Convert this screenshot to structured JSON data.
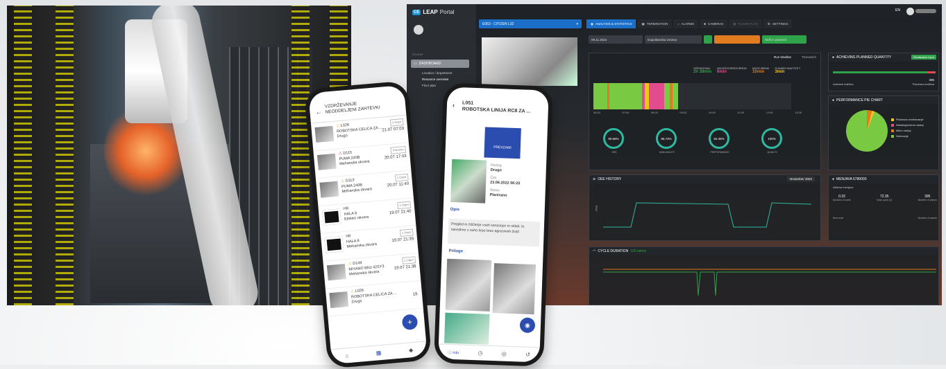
{
  "dashboard": {
    "brand": {
      "logo": "CE",
      "name": "LEAP",
      "portal": "Portal"
    },
    "sidebar": {
      "section": "ECLEAP",
      "dashboard_label": "DASHBOARD",
      "items": [
        "Location / department",
        "Resource overview",
        "Floor plan"
      ]
    },
    "machine_select": "E053 - CITIZEN L32",
    "tabs": [
      {
        "label": "ANALYSIS & STATISTICS",
        "icon": "chart-icon"
      },
      {
        "label": "TERMINATION",
        "icon": "stop-icon"
      },
      {
        "label": "ALARMS",
        "icon": "bell-icon"
      },
      {
        "label": "CAMERAS",
        "icon": "camera-icon"
      },
      {
        "label": "FLOOR PLAN",
        "icon": "map-icon"
      },
      {
        "label": "SETTINGS",
        "icon": "gear-icon"
      }
    ],
    "language": "EN",
    "controls": {
      "date": "09.11.2022",
      "period": "Dopoldanska izmena",
      "shift_btn": "Shift in planned"
    },
    "timeline": {
      "title": "Run timeline",
      "tab2": "Textswitch",
      "legend": [
        {
          "label": "OPERATIONAL",
          "value": "2h 38min",
          "color": "#2fa34a"
        },
        {
          "label": "UNCATEGORIZED BREAK",
          "value": "6min",
          "color": "#e24b8e"
        },
        {
          "label": "MICRO BREAK",
          "value": "10min",
          "color": "#e07b20"
        },
        {
          "label": "PLANNED INACTIVITY",
          "value": "3min",
          "color": "#f0c419"
        }
      ],
      "times": [
        "06:00",
        "07:00",
        "08:00",
        "09:00",
        "10:00",
        "11:00",
        "12:00",
        "13:00"
      ]
    },
    "gauges": [
      {
        "value": "90.66%",
        "label": "OEE"
      },
      {
        "value": "96.74%",
        "label": "AVAILABILITY"
      },
      {
        "value": "92.45%",
        "label": "PERFORMANCE"
      },
      {
        "value": "100%",
        "label": "QUALITY"
      }
    ],
    "achieving": {
      "title": "ACHIEVING PLANNED QUANTITY",
      "badge": "Realisation input",
      "left_label": "Izdelane količine",
      "right_label": "Planirana količina",
      "right_value": "395"
    },
    "performance_pie": {
      "title": "PERFORMANCE PIE CHART",
      "legend": [
        "Planirano nedelovanje",
        "Nekategoriziran zastoj",
        "Mikro zastoj",
        "Delovanje"
      ]
    },
    "oee_history": {
      "title": "OEE HISTORY",
      "month": "November 2022",
      "y_axis": "OEE"
    },
    "shift_panel": {
      "title": "MENJAVA 6780000",
      "subtitle": "Aktivna menjava",
      "stats": [
        {
          "value": "0.33",
          "label": "Number of users"
        },
        {
          "value": "72.35",
          "label": "Ideal cycle (s)"
        },
        {
          "value": "395",
          "label": "Number of pieces"
        }
      ],
      "cols": [
        "Item code",
        "Number of pieces"
      ]
    },
    "cycle": {
      "title": "CYCLE DURATION",
      "subtitle": "326 taktov"
    }
  },
  "phone1": {
    "title": "VZDRŽEVANJE",
    "subtitle": "NEODDELJENI ZAHTEVKI",
    "rows": [
      {
        "code": "L026",
        "name": "ROBOTSKA CELICA ZA ...",
        "type": "Drugo",
        "date": "21.07 07:03",
        "badge": "1 Odprt",
        "warn": "yellow"
      },
      {
        "code": "D115",
        "name": "PUMA 240B",
        "type": "Mehanska okvara",
        "date": "20.07 17:43",
        "badge": "Prevzeto",
        "warn": "red"
      },
      {
        "code": "D113",
        "name": "PUMA 240B",
        "type": "Mehanska okvara",
        "date": "20.07 11:40",
        "badge": "1 Odprt",
        "warn": "yellow"
      },
      {
        "code": "H8",
        "name": "HALA 8",
        "type": "Elektro okvara",
        "date": "19.07 21:40",
        "badge": "1 Odprt",
        "warn": "none"
      },
      {
        "code": "H8",
        "name": "HALA 8",
        "type": "Mehanska okvara",
        "date": "19.07 21:39",
        "badge": "1 Odprt",
        "warn": "none"
      },
      {
        "code": "D149",
        "name": "MIYANO BNJ 42SY3",
        "type": "Mehanska okvara",
        "date": "19.07 21:38",
        "badge": "1 Odprt",
        "warn": "yellow"
      },
      {
        "code": "L026",
        "name": "ROBOTSKA CELICA ZA ...",
        "type": "Drugo",
        "date": "19.",
        "badge": "",
        "warn": "yellow"
      }
    ],
    "fab": "+"
  },
  "phone2": {
    "code": "L051",
    "title": "ROBOTSKA LINIJA RC8 ZA ...",
    "action": "PREVZAMI",
    "info": [
      {
        "k": "Razlog",
        "v": "Drugo"
      },
      {
        "k": "Čas",
        "v": "23.06.2022 06:20"
      },
      {
        "k": "Status",
        "v": "Planirano"
      }
    ],
    "opis_label": "Opis",
    "opis_text": "Pregled in čiščenje vseh senzorjev in stikal, to naredimo s suho krpo brez agresivnih čistil",
    "priloge_label": "Priloge",
    "nav_info": "Info"
  }
}
